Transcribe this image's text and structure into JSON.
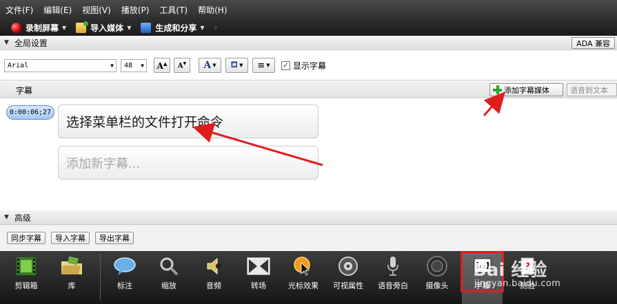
{
  "menubar": {
    "items": [
      "文件(F)",
      "编辑(E)",
      "视图(V)",
      "播放(P)",
      "工具(T)",
      "帮助(H)"
    ]
  },
  "toolbar": {
    "record_label": "录制屏幕",
    "import_label": "导入媒体",
    "share_label": "生成和分享"
  },
  "global_settings": {
    "header": "全局设置",
    "ada_label": "ADA 兼容",
    "font_name": "Arial",
    "font_size": "48",
    "show_captions_label": "显示字幕",
    "show_captions_checked": true
  },
  "captions": {
    "header": "字幕",
    "add_media_label": "添加字幕媒体",
    "speech_to_text_label": "语音到文本",
    "timestamp": "0:00:06;27",
    "first_caption": "选择菜单栏的文件打开命令",
    "add_new_placeholder": "添加新字幕..."
  },
  "advanced": {
    "header": "高级",
    "sync_label": "同步字幕",
    "import_label": "导入字幕",
    "export_label": "导出字幕"
  },
  "bottom_tools": [
    {
      "label": "剪辑箱",
      "icon": "filmstrip-icon"
    },
    {
      "label": "库",
      "icon": "library-folder-icon"
    },
    {
      "label": "标注",
      "icon": "callout-bubble-icon"
    },
    {
      "label": "缩放",
      "icon": "magnifier-icon"
    },
    {
      "label": "音频",
      "icon": "speaker-icon"
    },
    {
      "label": "转场",
      "icon": "transition-icon"
    },
    {
      "label": "光标效果",
      "icon": "cursor-effect-icon"
    },
    {
      "label": "可视属性",
      "icon": "visual-properties-icon"
    },
    {
      "label": "语音旁白",
      "icon": "microphone-icon"
    },
    {
      "label": "摄像头",
      "icon": "camera-icon"
    },
    {
      "label": "字幕",
      "icon": "captions-icon"
    },
    {
      "label": "测验",
      "icon": "quiz-icon"
    }
  ],
  "watermark": {
    "text": "Bai 经验",
    "url": "jingyan.baidu.com"
  },
  "colors": {
    "annotation_red": "#e01d1d",
    "timestamp_blue": "#a7c8f2",
    "plus_green": "#2aa52a"
  }
}
